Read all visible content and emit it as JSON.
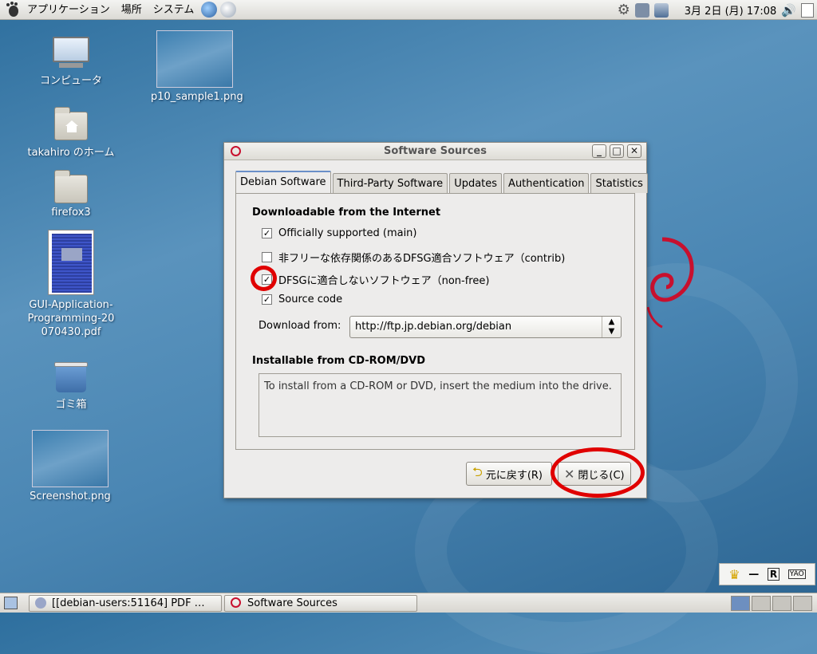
{
  "top_panel": {
    "menus": [
      "アプリケーション",
      "場所",
      "システム"
    ],
    "clock": "3月 2日 (月) 17:08"
  },
  "desktop": {
    "icons": [
      {
        "label": "コンピュータ"
      },
      {
        "label": "p10_sample1.png"
      },
      {
        "label": "takahiro のホーム"
      },
      {
        "label": "firefox3"
      },
      {
        "label": "GUI-Application-Programming-20070430.pdf"
      },
      {
        "label": "ゴミ箱"
      },
      {
        "label": "Screenshot.png"
      }
    ]
  },
  "window": {
    "title": "Software Sources",
    "controls": {
      "minimize": "_",
      "maximize": "□",
      "close": "✕"
    },
    "tabs": [
      {
        "label": "Debian Software",
        "active": true
      },
      {
        "label": "Third-Party Software"
      },
      {
        "label": "Updates"
      },
      {
        "label": "Authentication"
      },
      {
        "label": "Statistics"
      }
    ],
    "section_internet": "Downloadable from the Internet",
    "options": [
      {
        "label": "Officially supported (main)",
        "checked": true
      },
      {
        "label": "非フリーな依存関係のあるDFSG適合ソフトウェア（contrib)",
        "checked": false
      },
      {
        "label": "DFSGに適合しないソフトウェア（non-free)",
        "checked": true
      },
      {
        "label": "Source code",
        "checked": true
      }
    ],
    "download_from_label": "Download from:",
    "download_from_value": "http://ftp.jp.debian.org/debian",
    "section_cdrom": "Installable from CD-ROM/DVD",
    "cdrom_info": "To install from a CD-ROM or DVD, insert the medium into the drive.",
    "revert_button": "元に戻す(R)",
    "close_button": "閉じる(C)"
  },
  "taskbar": {
    "tasks": [
      {
        "label": "[[debian-users:51164] PDF …"
      },
      {
        "label": "Software Sources"
      }
    ]
  },
  "notification": {
    "items": [
      "♛",
      "—",
      "R",
      "YAO"
    ]
  },
  "colors": {
    "annotation": "#e00000",
    "desktop": "#4a86b3",
    "tab_accent": "#6a8fc8"
  }
}
